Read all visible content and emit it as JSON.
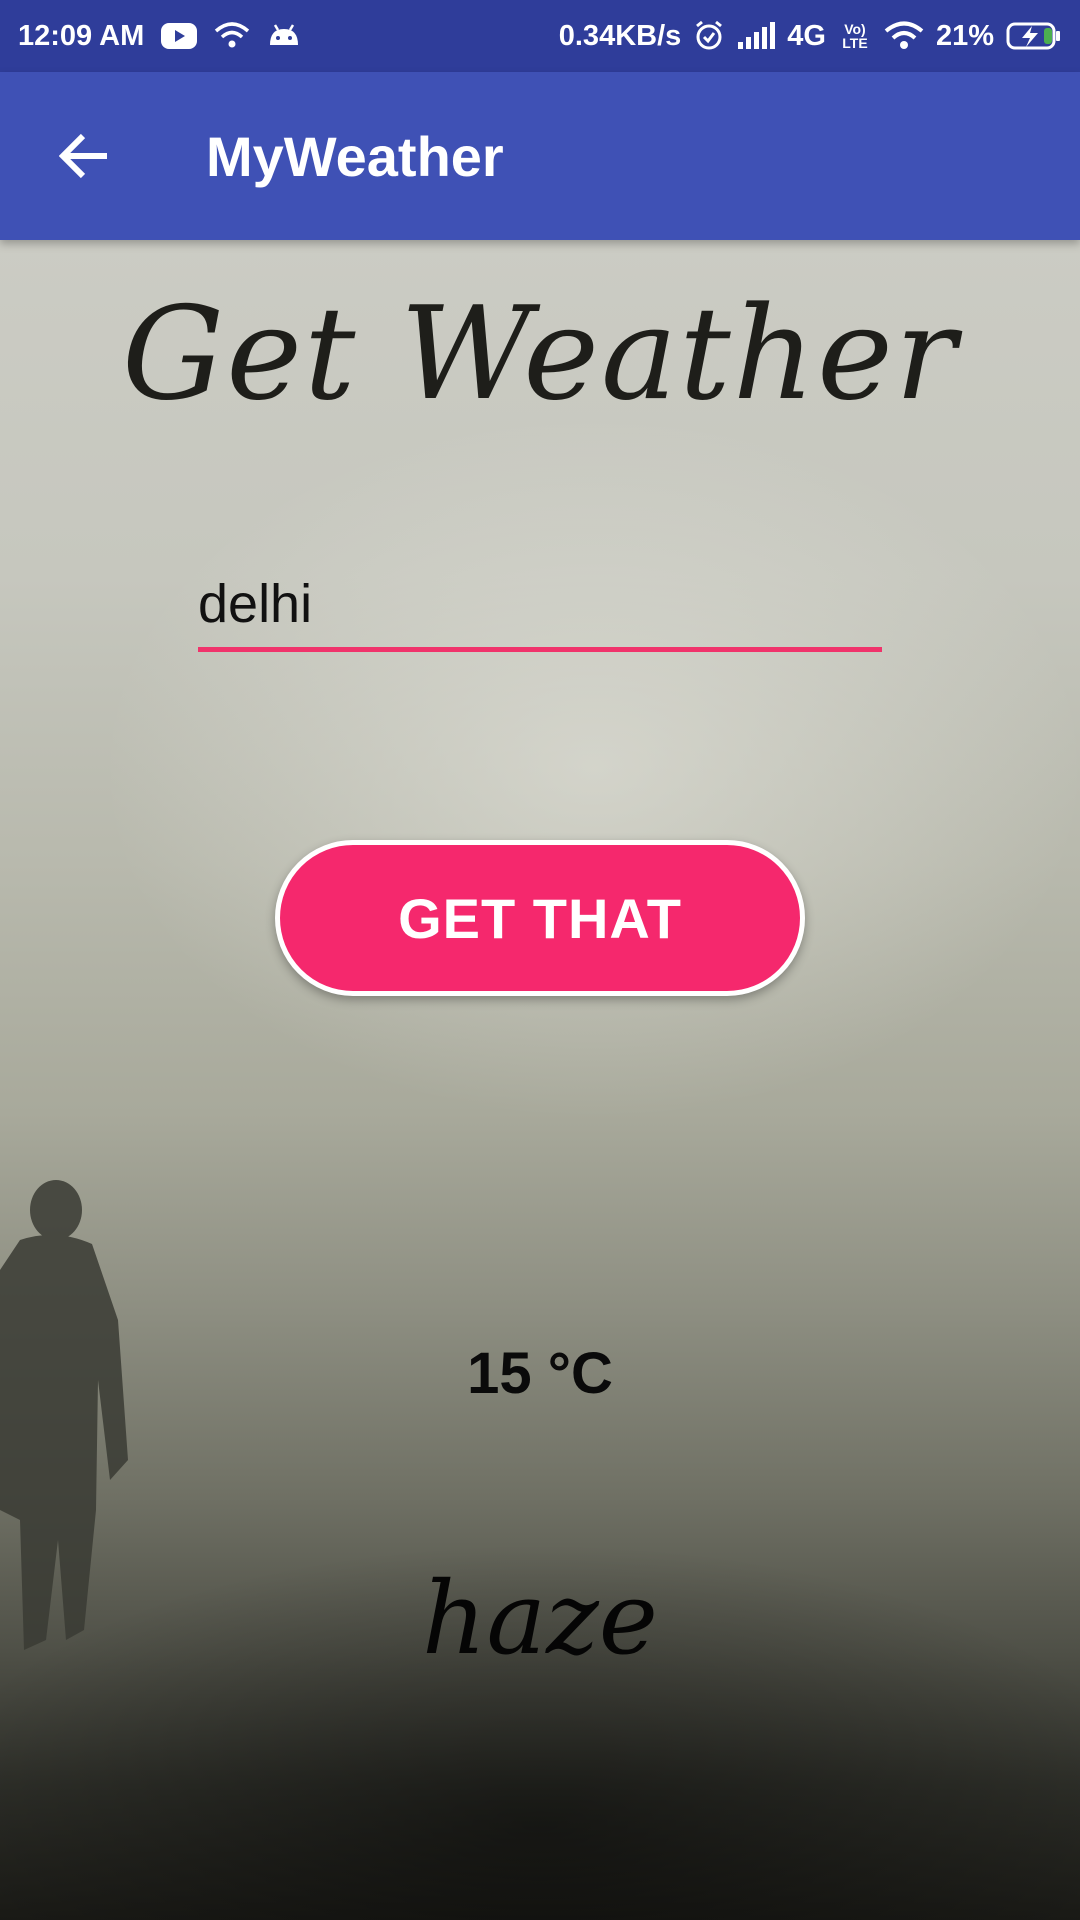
{
  "status_bar": {
    "time": "12:09 AM",
    "net_speed": "0.34KB/s",
    "network_type": "4G",
    "volte_label": "Vo) LTE",
    "battery_percent": "21%",
    "icons": [
      "youtube-icon",
      "wifi-icon",
      "android-icon",
      "alarm-icon",
      "signal-icon",
      "wifi-icon",
      "battery-charging-icon"
    ]
  },
  "app_bar": {
    "title": "MyWeather",
    "back_icon": "arrow-left-icon"
  },
  "main": {
    "heading": "Get Weather",
    "city_input_value": "delhi",
    "button_label": "GET THAT",
    "temperature": "15 °C",
    "condition": "haze"
  },
  "colors": {
    "status_bar": "#2f3d9a",
    "app_bar": "#3f51b5",
    "accent": "#f5286d",
    "input_underline": "#f0336b"
  }
}
